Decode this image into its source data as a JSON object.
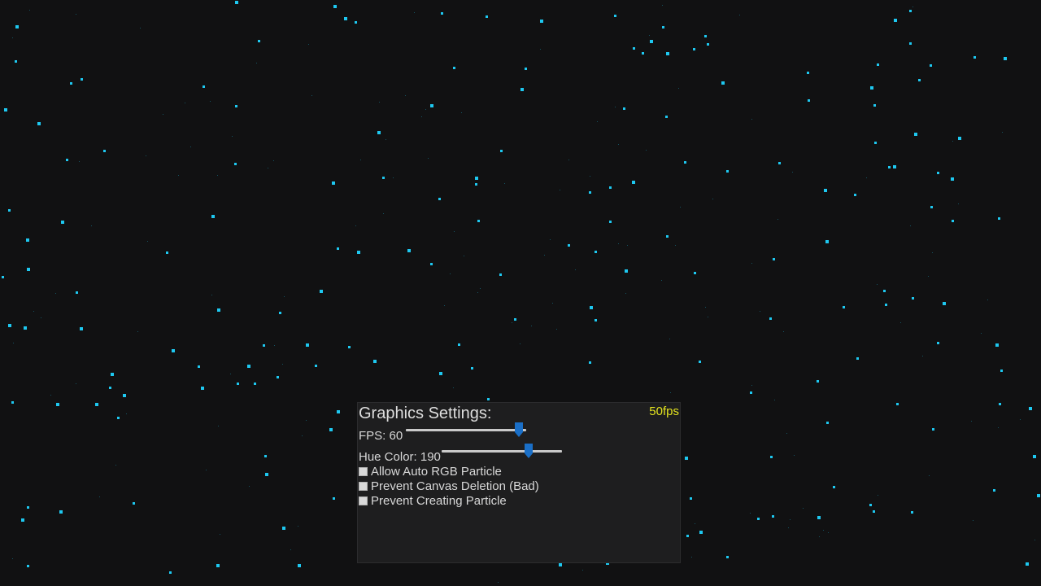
{
  "colors": {
    "background": "#111112",
    "particle": "#1ec8f0",
    "panel_background": "#1e1e1f",
    "fps_counter": "#e3e31f",
    "slider_thumb": "#1a6fc7",
    "slider_track": "#c9c9c9"
  },
  "settings_panel": {
    "title": "Graphics Settings:",
    "fps_counter": "50fps",
    "fps_label": "FPS: 60",
    "fps_slider_level": 0.94,
    "hue_label": "Hue Color: 190",
    "hue_slider_level": 0.72,
    "checkboxes": [
      {
        "label": "Allow Auto RGB Particle",
        "checked": false
      },
      {
        "label": "Prevent Canvas Deletion (Bad)",
        "checked": false
      },
      {
        "label": "Prevent Creating Particle",
        "checked": false
      }
    ]
  }
}
